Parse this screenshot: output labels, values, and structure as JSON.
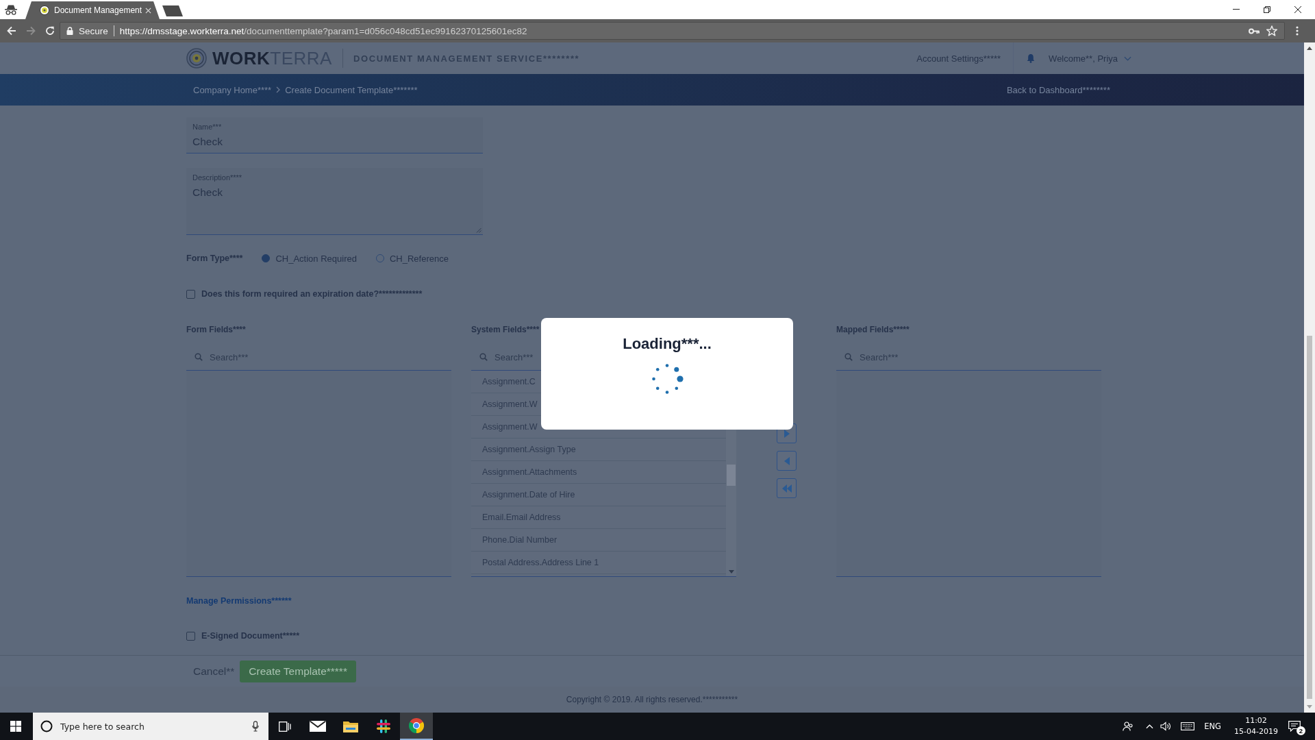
{
  "browser": {
    "tab_title": "Document Management",
    "security_label": "Secure",
    "url_origin": "https://dmsstage.workterra.net",
    "url_path": "/documenttemplate?param1=d056c048cd51ec99162370125601ec82"
  },
  "header": {
    "logo": "**WORK**TERRA",
    "service_name": "DOCUMENT MANAGEMENT SERVICE********",
    "account_settings": "Account Settings*****",
    "welcome": "Welcome**, Priya"
  },
  "breadcrumb": {
    "items": [
      "Company Home****",
      "Create Document Template*******"
    ],
    "back_link": "Back to Dashboard********"
  },
  "form": {
    "name": {
      "label": "Name***",
      "value": "Check"
    },
    "description": {
      "label": "Description****",
      "value": "Check"
    },
    "form_type": {
      "label": "Form Type****",
      "options": [
        {
          "label": "CH_Action Required",
          "selected": true
        },
        {
          "label": "CH_Reference",
          "selected": false
        }
      ]
    },
    "expiration": {
      "label": "Does this form required an expiration date?*************",
      "checked": false
    }
  },
  "field_mapping": {
    "form_fields": {
      "title": "Form Fields****",
      "placeholder": "Search***"
    },
    "system_fields": {
      "title": "System Fields****",
      "placeholder": "Search***",
      "items": [
        "Assignment.C",
        "Assignment.W",
        "Assignment.W",
        "Assignment.Assign Type",
        "Assignment.Attachments",
        "Assignment.Date of Hire",
        "Email.Email Address",
        "Phone.Dial Number",
        "Postal Address.Address Line 1"
      ]
    },
    "mapped_fields": {
      "title": "Mapped Fields*****",
      "placeholder": "Search***"
    }
  },
  "permissions": {
    "link": "Manage Permissions******",
    "e_signed": {
      "label": "E-Signed Document*****",
      "checked": false
    }
  },
  "actions": {
    "cancel": "Cancel**",
    "create": "Create Template*****"
  },
  "copyright": "Copyright © 2019. All rights reserved.***********",
  "loading_dialog": {
    "title": "Loading***..."
  },
  "taskbar": {
    "search_placeholder": "Type here to search",
    "apps": [
      {
        "kind": "task_view",
        "selected": false
      },
      {
        "kind": "mail",
        "selected": false
      },
      {
        "kind": "folder",
        "selected": false
      },
      {
        "kind": "chat",
        "selected": false
      },
      {
        "kind": "browser",
        "selected": true
      }
    ],
    "language": "ENG",
    "time": "11:02",
    "date": "15-04-2019",
    "notification_count": "2"
  }
}
